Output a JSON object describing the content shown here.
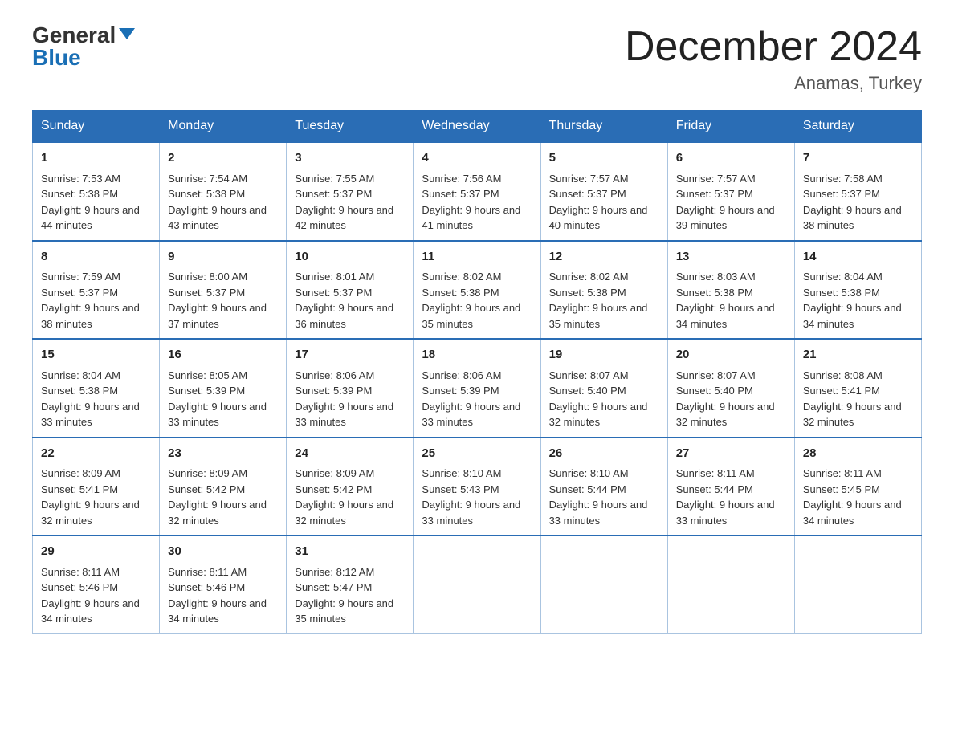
{
  "header": {
    "logo_line1": "General",
    "logo_line2": "Blue",
    "month_title": "December 2024",
    "location": "Anamas, Turkey"
  },
  "days_of_week": [
    "Sunday",
    "Monday",
    "Tuesday",
    "Wednesday",
    "Thursday",
    "Friday",
    "Saturday"
  ],
  "weeks": [
    [
      {
        "day": "1",
        "sunrise": "7:53 AM",
        "sunset": "5:38 PM",
        "daylight": "9 hours and 44 minutes."
      },
      {
        "day": "2",
        "sunrise": "7:54 AM",
        "sunset": "5:38 PM",
        "daylight": "9 hours and 43 minutes."
      },
      {
        "day": "3",
        "sunrise": "7:55 AM",
        "sunset": "5:37 PM",
        "daylight": "9 hours and 42 minutes."
      },
      {
        "day": "4",
        "sunrise": "7:56 AM",
        "sunset": "5:37 PM",
        "daylight": "9 hours and 41 minutes."
      },
      {
        "day": "5",
        "sunrise": "7:57 AM",
        "sunset": "5:37 PM",
        "daylight": "9 hours and 40 minutes."
      },
      {
        "day": "6",
        "sunrise": "7:57 AM",
        "sunset": "5:37 PM",
        "daylight": "9 hours and 39 minutes."
      },
      {
        "day": "7",
        "sunrise": "7:58 AM",
        "sunset": "5:37 PM",
        "daylight": "9 hours and 38 minutes."
      }
    ],
    [
      {
        "day": "8",
        "sunrise": "7:59 AM",
        "sunset": "5:37 PM",
        "daylight": "9 hours and 38 minutes."
      },
      {
        "day": "9",
        "sunrise": "8:00 AM",
        "sunset": "5:37 PM",
        "daylight": "9 hours and 37 minutes."
      },
      {
        "day": "10",
        "sunrise": "8:01 AM",
        "sunset": "5:37 PM",
        "daylight": "9 hours and 36 minutes."
      },
      {
        "day": "11",
        "sunrise": "8:02 AM",
        "sunset": "5:38 PM",
        "daylight": "9 hours and 35 minutes."
      },
      {
        "day": "12",
        "sunrise": "8:02 AM",
        "sunset": "5:38 PM",
        "daylight": "9 hours and 35 minutes."
      },
      {
        "day": "13",
        "sunrise": "8:03 AM",
        "sunset": "5:38 PM",
        "daylight": "9 hours and 34 minutes."
      },
      {
        "day": "14",
        "sunrise": "8:04 AM",
        "sunset": "5:38 PM",
        "daylight": "9 hours and 34 minutes."
      }
    ],
    [
      {
        "day": "15",
        "sunrise": "8:04 AM",
        "sunset": "5:38 PM",
        "daylight": "9 hours and 33 minutes."
      },
      {
        "day": "16",
        "sunrise": "8:05 AM",
        "sunset": "5:39 PM",
        "daylight": "9 hours and 33 minutes."
      },
      {
        "day": "17",
        "sunrise": "8:06 AM",
        "sunset": "5:39 PM",
        "daylight": "9 hours and 33 minutes."
      },
      {
        "day": "18",
        "sunrise": "8:06 AM",
        "sunset": "5:39 PM",
        "daylight": "9 hours and 33 minutes."
      },
      {
        "day": "19",
        "sunrise": "8:07 AM",
        "sunset": "5:40 PM",
        "daylight": "9 hours and 32 minutes."
      },
      {
        "day": "20",
        "sunrise": "8:07 AM",
        "sunset": "5:40 PM",
        "daylight": "9 hours and 32 minutes."
      },
      {
        "day": "21",
        "sunrise": "8:08 AM",
        "sunset": "5:41 PM",
        "daylight": "9 hours and 32 minutes."
      }
    ],
    [
      {
        "day": "22",
        "sunrise": "8:09 AM",
        "sunset": "5:41 PM",
        "daylight": "9 hours and 32 minutes."
      },
      {
        "day": "23",
        "sunrise": "8:09 AM",
        "sunset": "5:42 PM",
        "daylight": "9 hours and 32 minutes."
      },
      {
        "day": "24",
        "sunrise": "8:09 AM",
        "sunset": "5:42 PM",
        "daylight": "9 hours and 32 minutes."
      },
      {
        "day": "25",
        "sunrise": "8:10 AM",
        "sunset": "5:43 PM",
        "daylight": "9 hours and 33 minutes."
      },
      {
        "day": "26",
        "sunrise": "8:10 AM",
        "sunset": "5:44 PM",
        "daylight": "9 hours and 33 minutes."
      },
      {
        "day": "27",
        "sunrise": "8:11 AM",
        "sunset": "5:44 PM",
        "daylight": "9 hours and 33 minutes."
      },
      {
        "day": "28",
        "sunrise": "8:11 AM",
        "sunset": "5:45 PM",
        "daylight": "9 hours and 34 minutes."
      }
    ],
    [
      {
        "day": "29",
        "sunrise": "8:11 AM",
        "sunset": "5:46 PM",
        "daylight": "9 hours and 34 minutes."
      },
      {
        "day": "30",
        "sunrise": "8:11 AM",
        "sunset": "5:46 PM",
        "daylight": "9 hours and 34 minutes."
      },
      {
        "day": "31",
        "sunrise": "8:12 AM",
        "sunset": "5:47 PM",
        "daylight": "9 hours and 35 minutes."
      },
      null,
      null,
      null,
      null
    ]
  ],
  "labels": {
    "sunrise": "Sunrise:",
    "sunset": "Sunset:",
    "daylight": "Daylight:"
  }
}
